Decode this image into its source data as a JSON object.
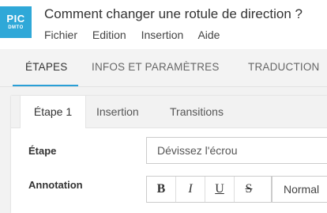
{
  "app": {
    "logo_line1": "PIC",
    "logo_line2": "DMTO",
    "title": "Comment changer une rotule de direction ?"
  },
  "menu": [
    "Fichier",
    "Edition",
    "Insertion",
    "Aide"
  ],
  "tabs": [
    {
      "label": "ÉTAPES",
      "active": true
    },
    {
      "label": "INFOS ET PARAMÈTRES",
      "active": false
    },
    {
      "label": "TRADUCTION",
      "active": false
    }
  ],
  "subtabs": [
    {
      "label": "Étape 1",
      "active": true
    },
    {
      "label": "Insertion",
      "active": false
    },
    {
      "label": "Transitions",
      "active": false
    }
  ],
  "form": {
    "etape_label": "Étape",
    "etape_value": "Dévissez l'écrou",
    "annotation_label": "Annotation",
    "toolbar": {
      "bold": "B",
      "italic": "I",
      "underline": "U",
      "strike": "S",
      "format_selected": "Normal"
    }
  },
  "colors": {
    "brand": "#2fa8d8",
    "active_tab_underline": "#2a9fd6"
  }
}
